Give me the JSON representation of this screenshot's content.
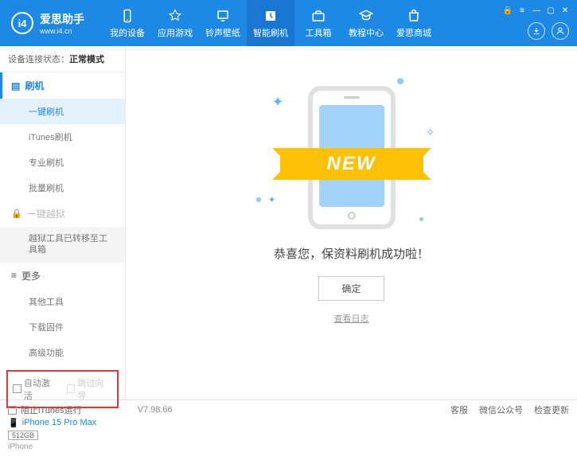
{
  "app": {
    "title": "爱思助手",
    "subtitle": "www.i4.cn",
    "logo_letter": "i4"
  },
  "nav": [
    {
      "label": "我的设备"
    },
    {
      "label": "应用游戏"
    },
    {
      "label": "铃声壁纸"
    },
    {
      "label": "智能刷机"
    },
    {
      "label": "工具箱"
    },
    {
      "label": "教程中心"
    },
    {
      "label": "爱思商城"
    }
  ],
  "status": {
    "label": "设备连接状态：",
    "value": "正常模式"
  },
  "sidebar": {
    "section1": "刷机",
    "items1": [
      "一键刷机",
      "iTunes刷机",
      "专业刷机",
      "批量刷机"
    ],
    "section2_locked": "一键越狱",
    "jailbreak_note": "越狱工具已转移至工具箱",
    "section3": "更多",
    "items3": [
      "其他工具",
      "下载固件",
      "高级功能"
    ]
  },
  "checkboxes": {
    "auto_activate": "自动激活",
    "skip_guide": "跳过向导"
  },
  "device": {
    "name": "iPhone 15 Pro Max",
    "storage": "512GB",
    "type": "iPhone"
  },
  "main": {
    "ribbon": "NEW",
    "success": "恭喜您，保资料刷机成功啦！",
    "ok": "确定",
    "log": "查看日志"
  },
  "footer": {
    "block_itunes": "阻止iTunes运行",
    "version": "V7.98.66",
    "links": [
      "客服",
      "微信公众号",
      "检查更新"
    ]
  }
}
